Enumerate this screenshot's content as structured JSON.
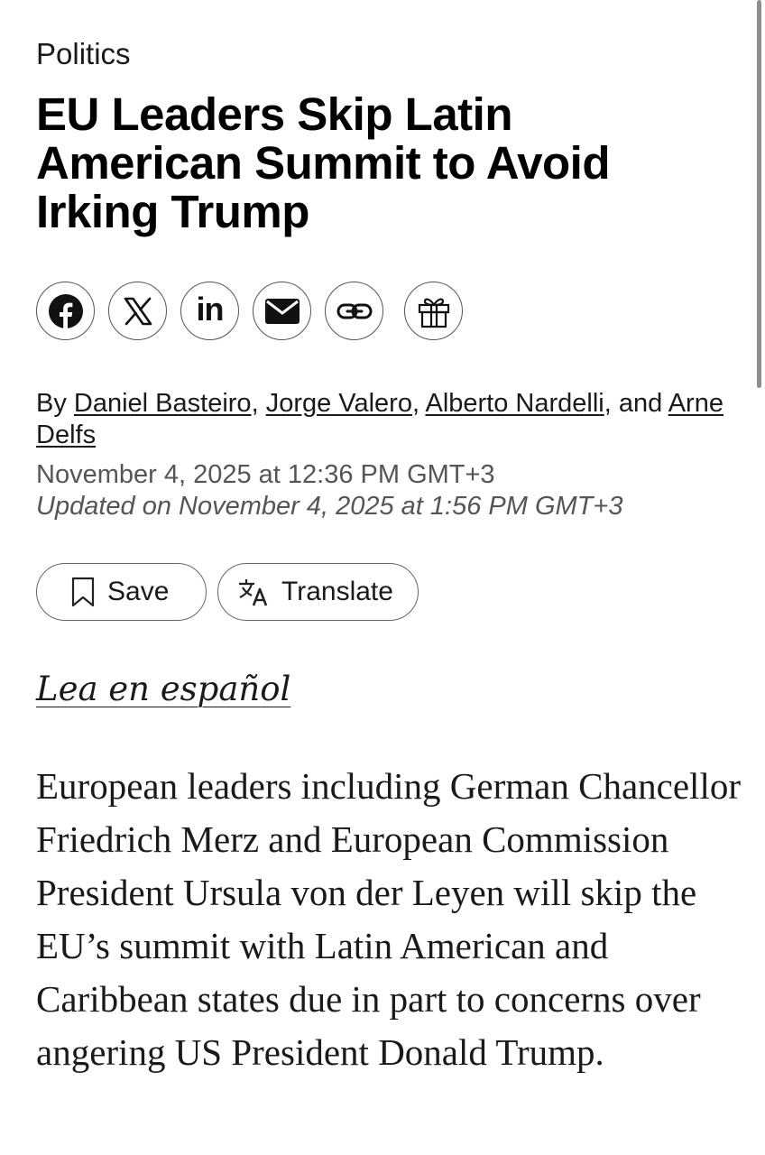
{
  "article": {
    "category": "Politics",
    "headline": "EU Leaders Skip Latin American Summit to Avoid Irking Trump",
    "byline": {
      "prefix": "By ",
      "authors": [
        "Daniel Basteiro",
        "Jorge Valero",
        "Alberto Nardelli",
        "Arne Delfs"
      ],
      "sep1": ", ",
      "sep2": ", ",
      "sep3": ", and "
    },
    "published": "November 4, 2025 at 12:36 PM GMT+3",
    "updated": "Updated on November 4, 2025 at 1:56 PM GMT+3",
    "spanish_link": "Lea en español",
    "body": "European leaders including German Chancellor Friedrich Merz and European Commission President Ursula von der Leyen will skip the EU’s summit with Latin American and Caribbean states due in part to concerns over angering US President Donald Trump."
  },
  "share": {
    "icons": [
      "facebook-icon",
      "x-icon",
      "linkedin-icon",
      "email-icon",
      "link-icon",
      "gift-icon"
    ],
    "linkedin_text": "in"
  },
  "actions": {
    "save_label": "Save",
    "translate_label": "Translate",
    "save_icon": "bookmark-icon",
    "translate_icon": "translate-icon"
  },
  "colors": {
    "text": "#1a1a1a",
    "meta": "#555555",
    "border": "#666666",
    "background": "#ffffff"
  }
}
